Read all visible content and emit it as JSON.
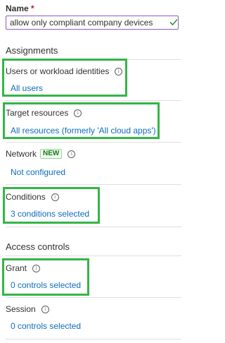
{
  "name_field": {
    "label": "Name",
    "required_marker": "*",
    "value": "allow only compliant company devices"
  },
  "assignments": {
    "title": "Assignments",
    "items": [
      {
        "label": "Users or workload identities",
        "value": "All users"
      },
      {
        "label": "Target resources",
        "value": "All resources (formerly 'All cloud apps')"
      },
      {
        "label": "Network",
        "badge": "NEW",
        "value": "Not configured"
      },
      {
        "label": "Conditions",
        "value": "3 conditions selected"
      }
    ]
  },
  "access_controls": {
    "title": "Access controls",
    "items": [
      {
        "label": "Grant",
        "value": "0 controls selected"
      },
      {
        "label": "Session",
        "value": "0 controls selected"
      }
    ]
  },
  "info_glyph": "i",
  "colors": {
    "link": "#0f6cbd",
    "highlight": "#34b548",
    "input_border": "#8a5fbf",
    "valid_check": "#107c10",
    "badge": "#107c10"
  }
}
